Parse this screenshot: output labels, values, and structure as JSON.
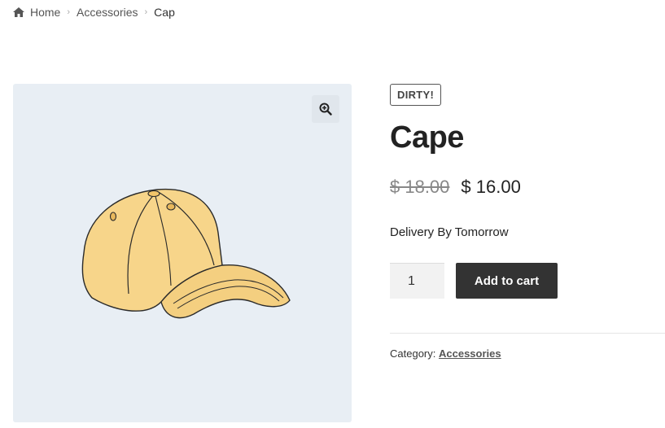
{
  "breadcrumb": {
    "icon": "home-icon",
    "items": [
      {
        "label": "Home"
      },
      {
        "label": "Accessories"
      },
      {
        "label": "Cap"
      }
    ]
  },
  "gallery": {
    "zoom_icon": "zoom-in-icon",
    "background": "#e8eef4"
  },
  "product": {
    "badge": "DIRTY!",
    "title": "Cape",
    "old_price": "$ 18.00",
    "price": "$ 16.00",
    "delivery": "Delivery By Tomorrow",
    "quantity": "1",
    "add_to_cart_label": "Add to cart",
    "category_label": "Category:",
    "category_value": "Accessories"
  },
  "colors": {
    "button_bg": "#333333",
    "cap_fill": "#f7d58a"
  }
}
